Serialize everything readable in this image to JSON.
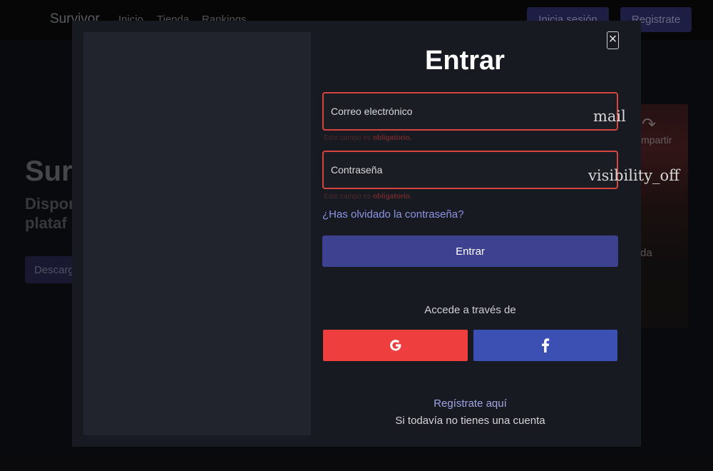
{
  "navbar": {
    "brand": "Survivor",
    "links": [
      "Inicio",
      "Tienda",
      "Rankings"
    ],
    "login_button": "Inicia sesión",
    "register_button": "Registrate"
  },
  "hero": {
    "title": "Surv",
    "subtitle": "Dispon plataf",
    "download_button": "Descarg"
  },
  "video": {
    "share_icon": "↷",
    "share_label": "mpartir",
    "suffix_text": "da"
  },
  "modal": {
    "close_icon": "×",
    "title": "Entrar",
    "email": {
      "label": "Correo electrónico",
      "icon": "mail"
    },
    "email_error": {
      "text": "Este campo es ",
      "strong": "obligatorio."
    },
    "password": {
      "label": "Contraseña",
      "icon": "visibility_off"
    },
    "password_error": {
      "text": "Este campo es ",
      "strong": "obligatorio."
    },
    "forgot_link": "¿Has olvidado la contraseña?",
    "submit_button": "Entrar",
    "social_caption": "Accede a través de",
    "social": {
      "google_color": "#ef3e3e",
      "facebook_color": "#3c4fb2"
    },
    "register_link": "Regístrate aquí",
    "register_note": "Si todavía no tienes una cuenta"
  },
  "colors": {
    "accent": "#3d418f",
    "error": "#d6453d",
    "link": "#8f93e4"
  }
}
